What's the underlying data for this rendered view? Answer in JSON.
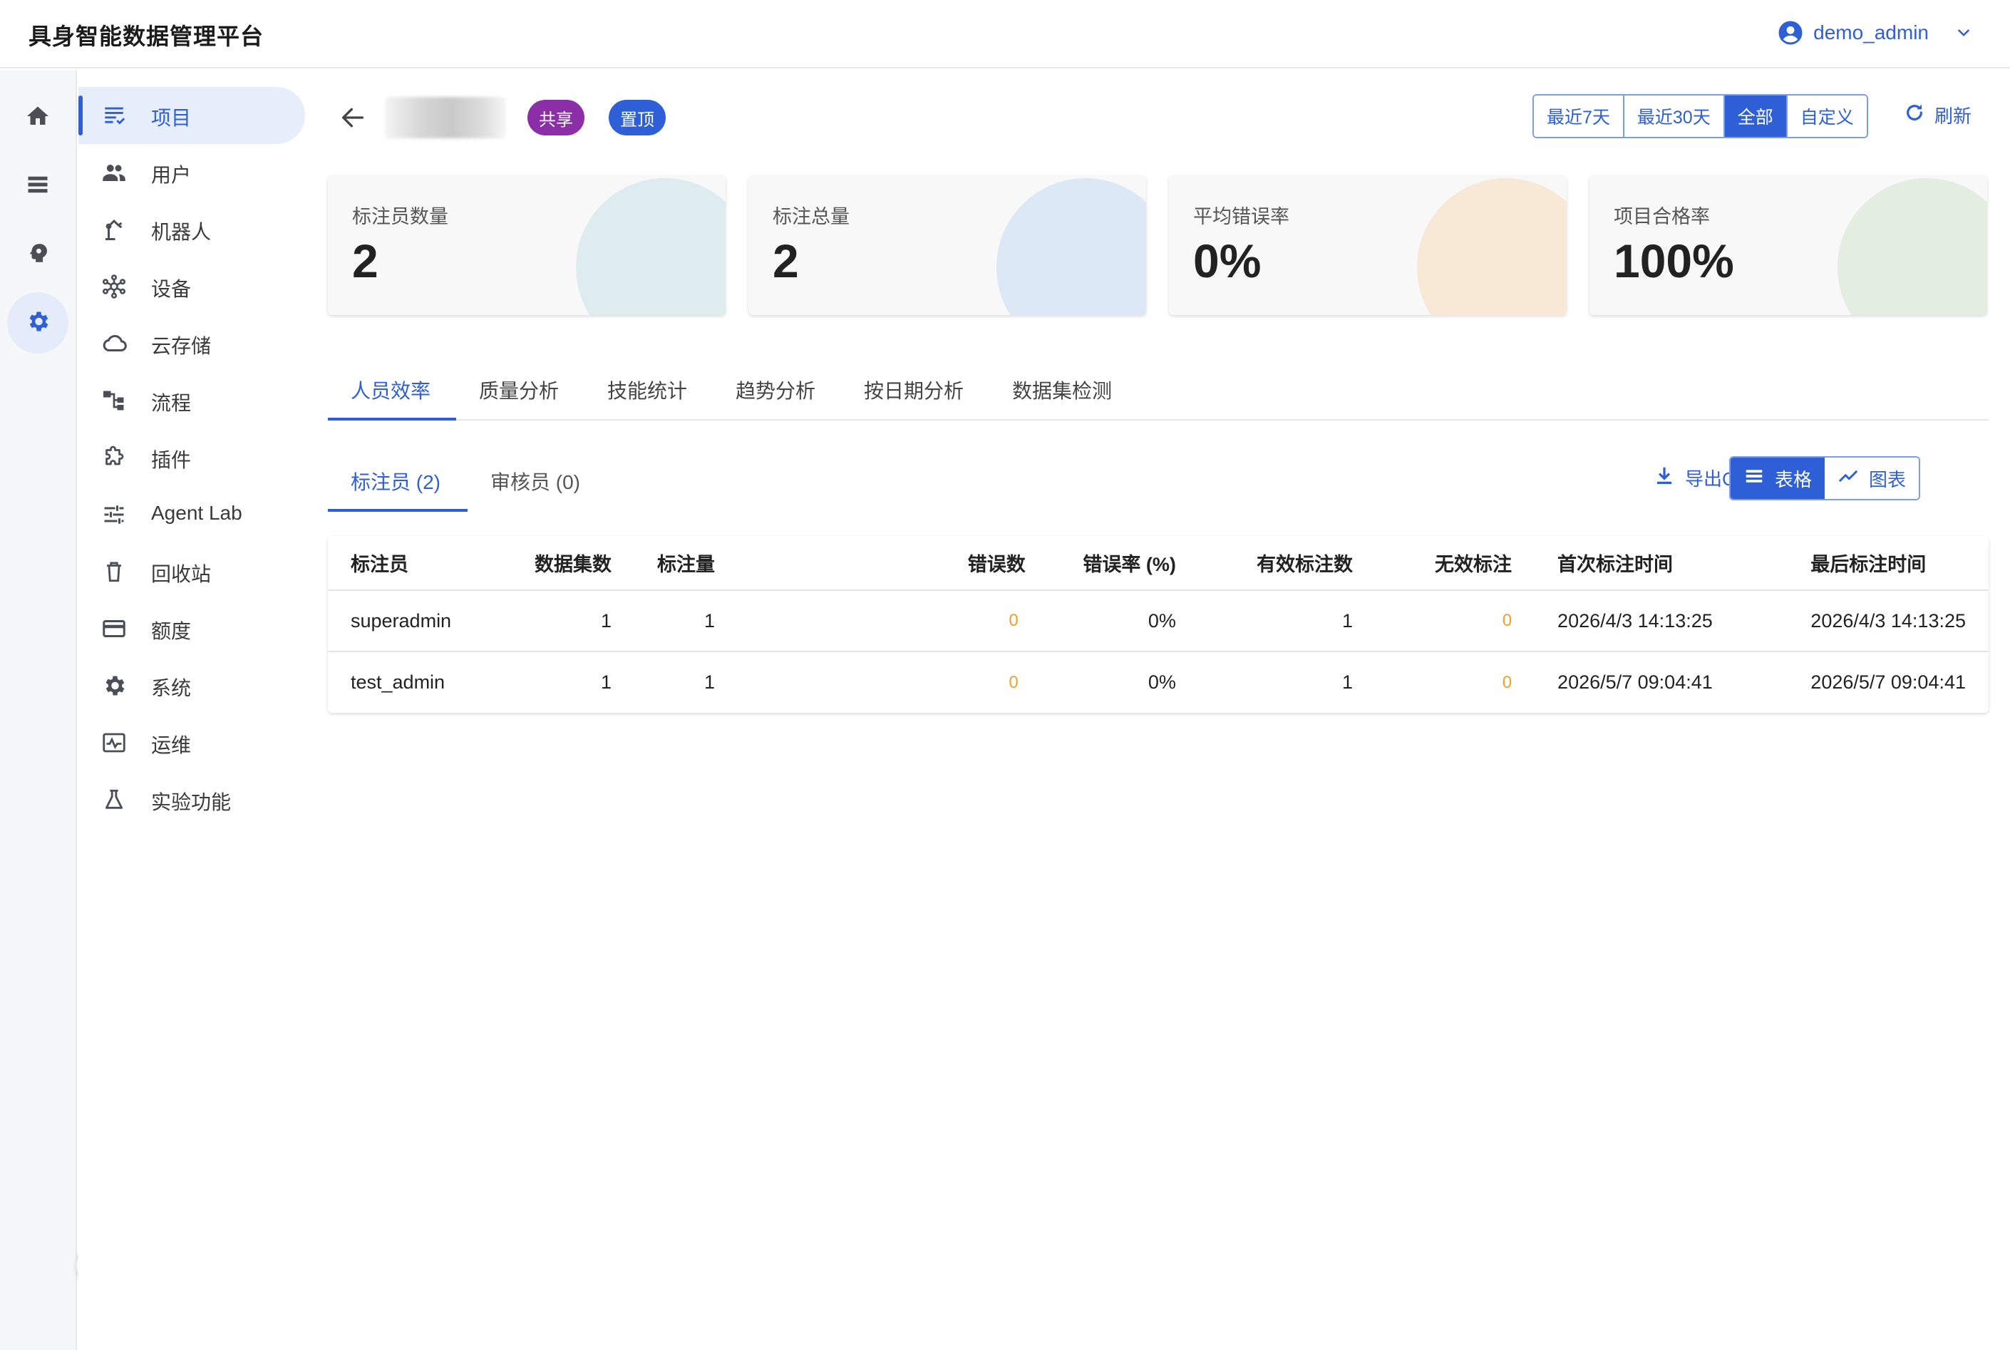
{
  "app": {
    "title": "具身智能数据管理平台",
    "user": "demo_admin"
  },
  "rail": [
    {
      "icon": "home-icon"
    },
    {
      "icon": "list-icon"
    },
    {
      "icon": "brain-icon"
    },
    {
      "icon": "gear-icon",
      "active": true
    }
  ],
  "sidebar": {
    "items": [
      {
        "label": "项目",
        "icon": "project-list-icon",
        "active": true
      },
      {
        "label": "用户",
        "icon": "users-icon"
      },
      {
        "label": "机器人",
        "icon": "robot-arm-icon"
      },
      {
        "label": "设备",
        "icon": "device-hub-icon"
      },
      {
        "label": "云存储",
        "icon": "cloud-icon"
      },
      {
        "label": "流程",
        "icon": "workflow-icon"
      },
      {
        "label": "插件",
        "icon": "puzzle-icon"
      },
      {
        "label": "Agent Lab",
        "icon": "tune-icon"
      },
      {
        "label": "回收站",
        "icon": "trash-icon"
      },
      {
        "label": "额度",
        "icon": "credit-card-icon"
      },
      {
        "label": "系统",
        "icon": "gear-icon"
      },
      {
        "label": "运维",
        "icon": "monitor-icon"
      },
      {
        "label": "实验功能",
        "icon": "flask-icon"
      }
    ]
  },
  "header": {
    "chips": {
      "share": "共享",
      "pinned": "置顶"
    },
    "ranges": [
      {
        "label": "最近7天"
      },
      {
        "label": "最近30天"
      },
      {
        "label": "全部",
        "active": true
      },
      {
        "label": "自定义"
      }
    ],
    "refresh": "刷新"
  },
  "stats": [
    {
      "label": "标注员数量",
      "value": "2",
      "color": "#dcecef"
    },
    {
      "label": "标注总量",
      "value": "2",
      "color": "#dde8f6"
    },
    {
      "label": "平均错误率",
      "value": "0%",
      "color": "#f8e8d6"
    },
    {
      "label": "项目合格率",
      "value": "100%",
      "color": "#e3ede0"
    }
  ],
  "tabs": [
    "人员效率",
    "质量分析",
    "技能统计",
    "趋势分析",
    "按日期分析",
    "数据集检测"
  ],
  "subtabs": [
    "标注员 (2)",
    "审核员 (0)"
  ],
  "toolbar": {
    "export": "导出CSV",
    "table_view": "表格",
    "chart_view": "图表"
  },
  "table": {
    "columns": [
      "标注员",
      "数据集数",
      "标注量",
      "错误数",
      "错误率 (%)",
      "有效标注数",
      "无效标注",
      "首次标注时间",
      "最后标注时间"
    ],
    "rows": [
      [
        "superadmin",
        "1",
        "1",
        "0",
        "0%",
        "1",
        "0",
        "2026/4/3 14:13:25",
        "2026/4/3 14:13:25"
      ],
      [
        "test_admin",
        "1",
        "1",
        "0",
        "0%",
        "1",
        "0",
        "2026/5/7 09:04:41",
        "2026/5/7 09:04:41"
      ]
    ]
  },
  "colors": {
    "accent": "#2f5fd6",
    "warning": "#f0a030",
    "share_chip": "#8b2ea8"
  }
}
